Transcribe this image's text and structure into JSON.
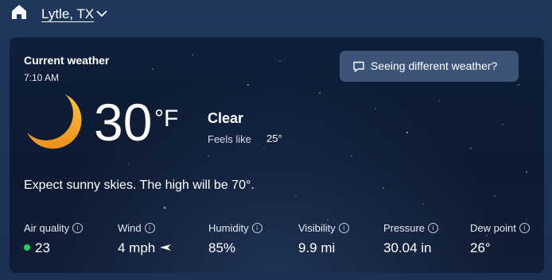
{
  "header": {
    "location": "Lytle, TX"
  },
  "current": {
    "title": "Current weather",
    "time": "7:10 AM",
    "temperature": "30",
    "unit": "°F",
    "condition": "Clear",
    "feels_like_label": "Feels like",
    "feels_like_value": "25°",
    "feedback_button": "Seeing different weather?",
    "forecast_text": "Expect sunny skies. The high will be 70°."
  },
  "metrics": [
    {
      "label": "Air quality",
      "value": "23"
    },
    {
      "label": "Wind",
      "value": "4 mph"
    },
    {
      "label": "Humidity",
      "value": "85%"
    },
    {
      "label": "Visibility",
      "value": "9.9 mi"
    },
    {
      "label": "Pressure",
      "value": "30.04 in"
    },
    {
      "label": "Dew point",
      "value": "26°"
    }
  ],
  "icons": {
    "home": "home-icon",
    "chevron": "chevron-down-icon",
    "moon": "crescent-moon-icon",
    "chat": "chat-bubble-icon",
    "info": "info-icon",
    "wind_direction": "wind-direction-arrow-icon",
    "air_quality_dot": "status-dot-icon"
  },
  "colors": {
    "air_quality_good": "#1fd15c",
    "moon": "#f3a529",
    "button_bg": "#3d5478"
  }
}
